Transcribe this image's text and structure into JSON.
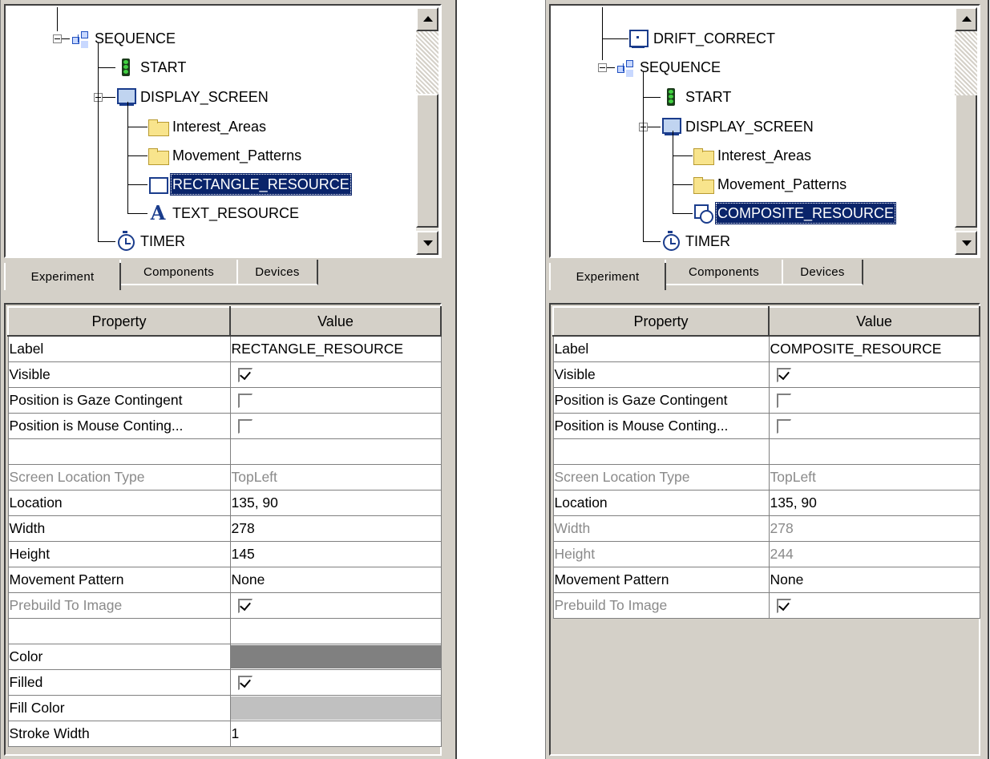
{
  "left": {
    "tree": {
      "nodes": [
        {
          "label": "SEQUENCE",
          "icon": "sequence-icon"
        },
        {
          "label": "START",
          "icon": "start-icon"
        },
        {
          "label": "DISPLAY_SCREEN",
          "icon": "display-screen-icon"
        },
        {
          "label": "Interest_Areas",
          "icon": "folder-icon"
        },
        {
          "label": "Movement_Patterns",
          "icon": "folder-icon"
        },
        {
          "label": "RECTANGLE_RESOURCE",
          "icon": "rectangle-icon",
          "selected": true
        },
        {
          "label": "TEXT_RESOURCE",
          "icon": "text-icon"
        },
        {
          "label": "TIMER",
          "icon": "timer-icon"
        }
      ]
    },
    "tabs": [
      "Experiment",
      "Components",
      "Devices"
    ],
    "headers": {
      "property": "Property",
      "value": "Value"
    },
    "rows": [
      {
        "property": "Label",
        "value": "RECTANGLE_RESOURCE"
      },
      {
        "property": "Visible",
        "checkbox": true,
        "checked": true
      },
      {
        "property": "Position is Gaze Contingent",
        "checkbox": true,
        "checked": false
      },
      {
        "property": "Position is Mouse Conting...",
        "checkbox": true,
        "checked": false
      },
      {
        "property": "",
        "value": ""
      },
      {
        "property": "Screen Location Type",
        "value": "TopLeft",
        "disabled": true
      },
      {
        "property": "Location",
        "value": "135, 90"
      },
      {
        "property": "Width",
        "value": "278"
      },
      {
        "property": "Height",
        "value": "145"
      },
      {
        "property": "Movement Pattern",
        "value": "None"
      },
      {
        "property": "Prebuild To Image",
        "checkbox": true,
        "checked": true,
        "disabled": true
      },
      {
        "property": "",
        "value": ""
      },
      {
        "property": "Color",
        "color": "#808080"
      },
      {
        "property": "Filled",
        "checkbox": true,
        "checked": true
      },
      {
        "property": "Fill Color",
        "color": "#c0c0c0"
      },
      {
        "property": "Stroke Width",
        "value": "1"
      }
    ]
  },
  "right": {
    "tree": {
      "nodes": [
        {
          "label": "DRIFT_CORRECT",
          "icon": "drift-correct-icon"
        },
        {
          "label": "SEQUENCE",
          "icon": "sequence-icon"
        },
        {
          "label": "START",
          "icon": "start-icon"
        },
        {
          "label": "DISPLAY_SCREEN",
          "icon": "display-screen-icon"
        },
        {
          "label": "Interest_Areas",
          "icon": "folder-icon"
        },
        {
          "label": "Movement_Patterns",
          "icon": "folder-icon"
        },
        {
          "label": "COMPOSITE_RESOURCE",
          "icon": "composite-icon",
          "selected": true
        },
        {
          "label": "TIMER",
          "icon": "timer-icon"
        }
      ]
    },
    "tabs": [
      "Experiment",
      "Components",
      "Devices"
    ],
    "headers": {
      "property": "Property",
      "value": "Value"
    },
    "rows": [
      {
        "property": "Label",
        "value": "COMPOSITE_RESOURCE"
      },
      {
        "property": "Visible",
        "checkbox": true,
        "checked": true
      },
      {
        "property": "Position is Gaze Contingent",
        "checkbox": true,
        "checked": false
      },
      {
        "property": "Position is Mouse Conting...",
        "checkbox": true,
        "checked": false
      },
      {
        "property": "",
        "value": ""
      },
      {
        "property": "Screen Location Type",
        "value": "TopLeft",
        "disabled": true
      },
      {
        "property": "Location",
        "value": "135, 90"
      },
      {
        "property": "Width",
        "value": "278",
        "disabled": true
      },
      {
        "property": "Height",
        "value": "244",
        "disabled": true
      },
      {
        "property": "Movement Pattern",
        "value": "None"
      },
      {
        "property": "Prebuild To Image",
        "checkbox": true,
        "checked": true,
        "disabled": true
      }
    ]
  }
}
